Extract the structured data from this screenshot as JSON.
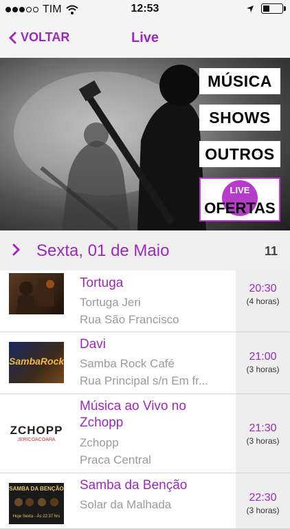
{
  "status_bar": {
    "carrier": "TIM",
    "time": "12:53"
  },
  "nav": {
    "back_label": "VOLTAR",
    "title": "Live"
  },
  "banner": {
    "menu": [
      "MÚSICA",
      "SHOWS",
      "OUTROS"
    ],
    "offer_badge": "LIVE",
    "offer_label": "OFERTAS"
  },
  "section": {
    "date_label": "Sexta, 01 de Maio",
    "count": "11"
  },
  "events": [
    {
      "name": "Tortuga",
      "venue": "Tortuga Jeri",
      "address": "Rua São Francisco",
      "time": "20:30",
      "duration": "(4 horas)"
    },
    {
      "name": "Davi",
      "venue": "Samba Rock Café",
      "address": "Rua Principal s/n  Em fr...",
      "time": "21:00",
      "duration": "(3 horas)",
      "thumb_text": "SambaRock"
    },
    {
      "name": "Música ao Vivo no Zchopp",
      "venue": "Zchopp",
      "address": "Praca Central",
      "time": "21:30",
      "duration": "(3 horas)",
      "thumb_text": "ZCHOPP",
      "thumb_sub": "JERICOACOARA"
    },
    {
      "name": "Samba da Benção",
      "venue": "Solar da Malhada",
      "address": "",
      "time": "22:30",
      "duration": "(3 horas)",
      "thumb_text": "SAMBA DA BENÇÃO",
      "thumb_sub": "Hoje Sexta - Às 22:37 hrs"
    }
  ],
  "colors": {
    "accent": "#9b2ab8",
    "offer": "#b43cc8"
  }
}
